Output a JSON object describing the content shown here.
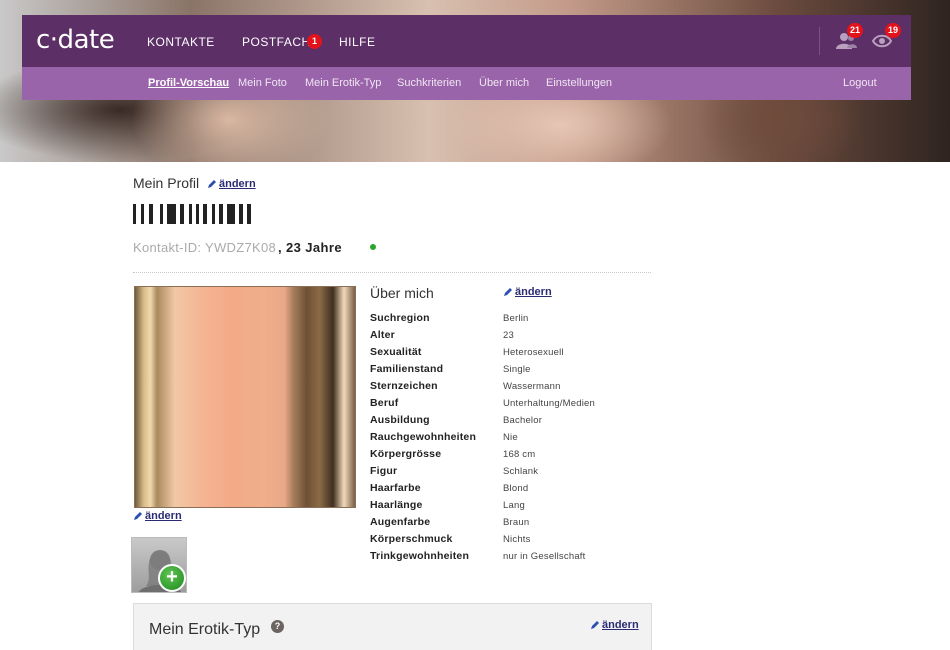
{
  "brand": {
    "logo": "c·date"
  },
  "nav": {
    "items": [
      {
        "label": "KONTAKTE"
      },
      {
        "label": "POSTFACH",
        "badge": "1"
      },
      {
        "label": "HILFE"
      }
    ],
    "contacts_badge": "21",
    "visitors_badge": "19"
  },
  "subnav": {
    "items": [
      {
        "label": "Profil-Vorschau",
        "active": true
      },
      {
        "label": "Mein Foto"
      },
      {
        "label": "Mein Erotik-Typ"
      },
      {
        "label": "Suchkriterien"
      },
      {
        "label": "Über mich"
      },
      {
        "label": "Einstellungen"
      }
    ],
    "logout": "Logout"
  },
  "profile": {
    "title": "Mein Profil",
    "edit_label": "ändern",
    "contact_id": "Kontakt-ID: YWDZ7K08",
    "age": ", 23 Jahre",
    "status_color": "#2aa52a"
  },
  "about": {
    "title": "Über mich",
    "edit_label": "ändern",
    "attributes": [
      {
        "label": "Suchregion",
        "value": "Berlin"
      },
      {
        "label": "Alter",
        "value": "23"
      },
      {
        "label": "Sexualität",
        "value": "Heterosexuell"
      },
      {
        "label": "Familienstand",
        "value": "Single"
      },
      {
        "label": "Sternzeichen",
        "value": "Wassermann"
      },
      {
        "label": "Beruf",
        "value": "Unterhaltung/Medien"
      },
      {
        "label": "Ausbildung",
        "value": "Bachelor"
      },
      {
        "label": "Rauchgewohnheiten",
        "value": "Nie"
      },
      {
        "label": "Körpergrösse",
        "value": "168 cm"
      },
      {
        "label": "Figur",
        "value": "Schlank"
      },
      {
        "label": "Haarfarbe",
        "value": "Blond"
      },
      {
        "label": "Haarlänge",
        "value": "Lang"
      },
      {
        "label": "Augenfarbe",
        "value": "Braun"
      },
      {
        "label": "Körperschmuck",
        "value": "Nichts"
      },
      {
        "label": "Trinkgewohnheiten",
        "value": "nur in Gesellschaft"
      }
    ]
  },
  "photo": {
    "edit_label": "ändern",
    "add_symbol": "+"
  },
  "erotik": {
    "title": "Mein Erotik-Typ",
    "help": "?",
    "edit_label": "ändern"
  },
  "colors": {
    "nav_bg": "#5c2f66",
    "subnav_bg": "#9a64aa",
    "badge": "#e3131b",
    "link": "#2b2b73"
  }
}
